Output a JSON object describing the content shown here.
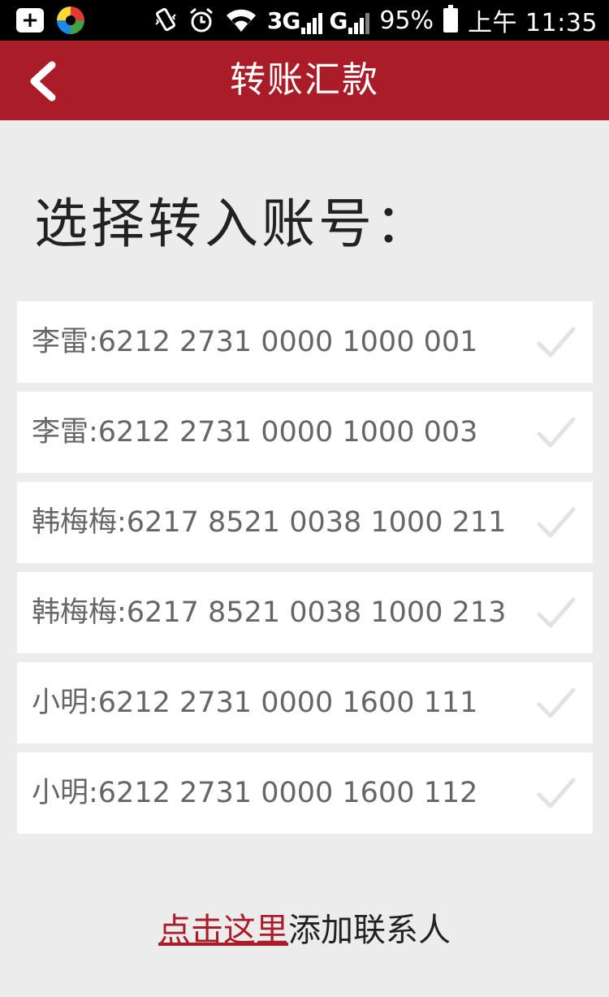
{
  "status_bar": {
    "battery": "95%",
    "time": "上午 11:35",
    "network_1": "3G",
    "network_2": "G"
  },
  "nav": {
    "title": "转账汇款"
  },
  "heading": "选择转入账号：",
  "accounts": [
    {
      "label": "李雷:6212 2731 0000 1000 001"
    },
    {
      "label": "李雷:6212 2731 0000 1000 003"
    },
    {
      "label": "韩梅梅:6217 8521 0038 1000 211"
    },
    {
      "label": "韩梅梅:6217 8521 0038 1000 213"
    },
    {
      "label": "小明:6212 2731 0000 1600 111"
    },
    {
      "label": "小明:6212 2731 0000 1600 112"
    }
  ],
  "footer": {
    "link_text": "点击这里",
    "rest_text": "添加联系人"
  },
  "colors": {
    "brand_red": "#aa1c28",
    "background": "#ececec"
  },
  "icons": [
    "add-notification-icon",
    "pinwheel-app-icon",
    "vibrate-icon",
    "alarm-icon",
    "wifi-icon",
    "signal-icon",
    "battery-icon",
    "back-arrow-icon",
    "check-icon"
  ]
}
